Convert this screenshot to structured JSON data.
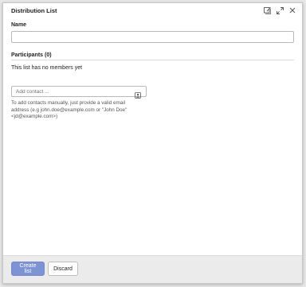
{
  "dialog": {
    "title": "Distribution List"
  },
  "title_icons": [
    "edit-dock-icon",
    "expand-icon",
    "close-icon"
  ],
  "form": {
    "name_label": "Name",
    "name_value": "",
    "participants_label": "Participants (0)",
    "empty_message": "This list has no members yet",
    "contact_placeholder": "Add contact ...",
    "help_text": "To add contacts manually, just provide a valid email address (e.g john.doe@example.com or \"John Doe\" <jd@example.com>)"
  },
  "footer": {
    "create_label": "Create list",
    "discard_label": "Discard"
  },
  "colors": {
    "primary_button": "#7d93d4",
    "footer_background": "#ebebeb"
  }
}
